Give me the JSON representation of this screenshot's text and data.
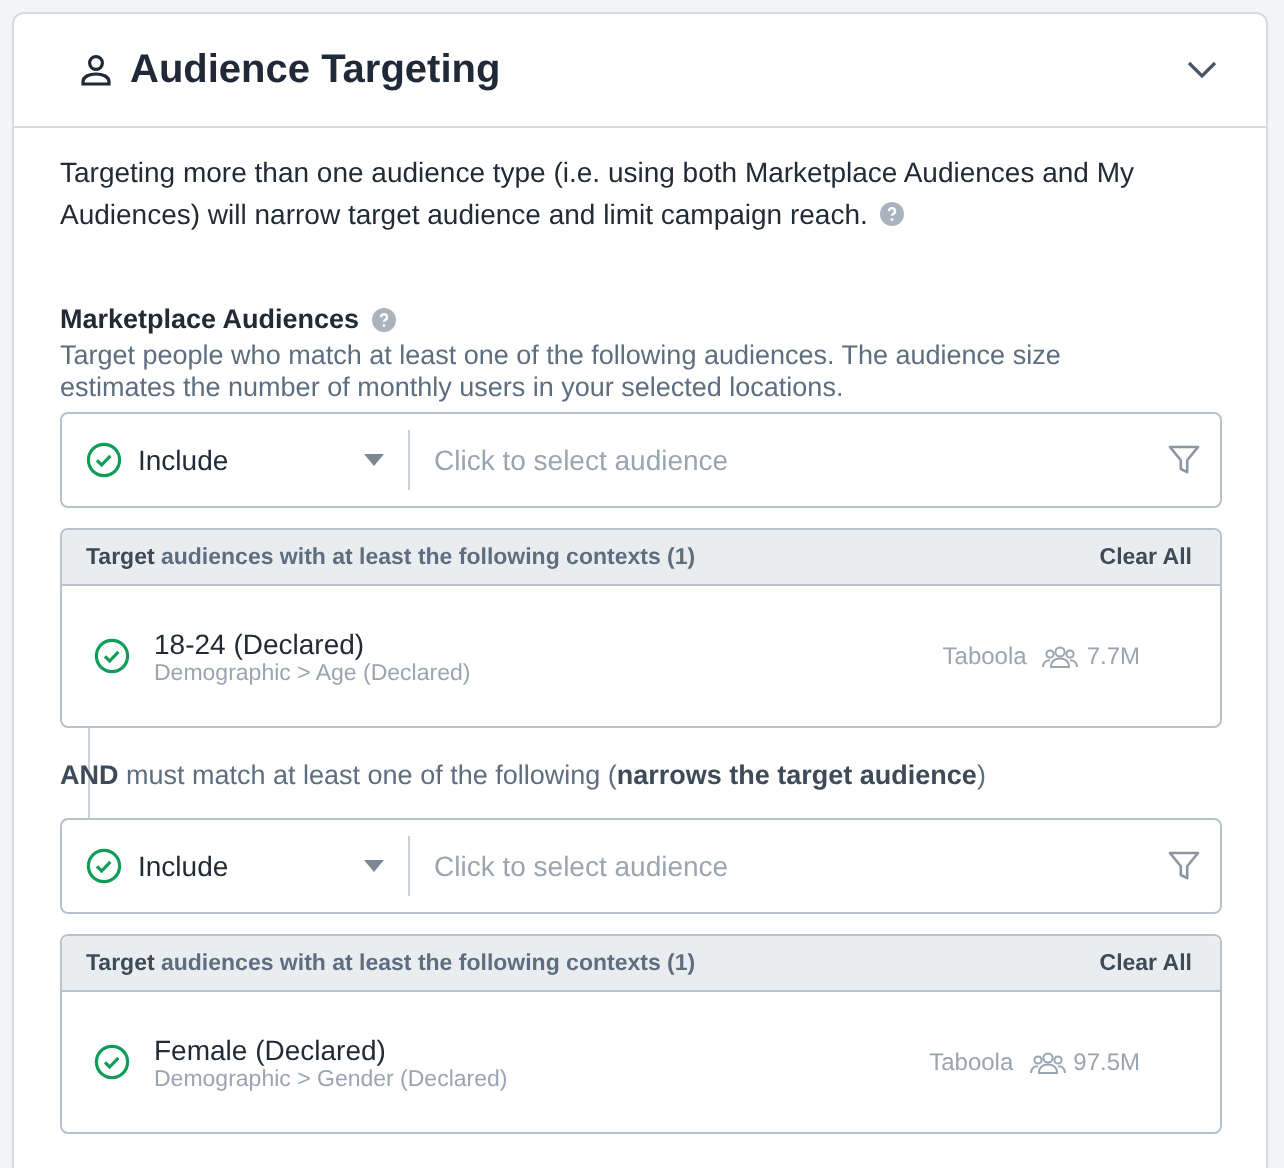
{
  "section": {
    "title": "Audience Targeting",
    "expanded": true
  },
  "notice": "Targeting more than one audience type (i.e. using both Marketplace Audiences and My Audiences) will narrow target audience and limit campaign reach.",
  "marketplace": {
    "title": "Marketplace Audiences",
    "description": "Target people who match at least one of the following audiences. The audience size estimates the number of monthly users in your selected locations.",
    "groups": [
      {
        "select": {
          "mode": "Include",
          "placeholder": "Click to select audience"
        },
        "contexts": {
          "header": "**Target** audiences with at least the following contexts (1)",
          "clear": "Clear All",
          "items": [
            {
              "name": "18-24 (Declared)",
              "path": "Demographic > Age (Declared)",
              "provider": "Taboola",
              "size": "7.7M"
            }
          ]
        }
      },
      {
        "connector": "**AND** must match at least one of the following (**narrows the target audience**)",
        "select": {
          "mode": "Include",
          "placeholder": "Click to select audience"
        },
        "contexts": {
          "header": "**Target** audiences with at least the following contexts (1)",
          "clear": "Clear All",
          "items": [
            {
              "name": "Female (Declared)",
              "path": "Demographic > Gender (Declared)",
              "provider": "Taboola",
              "size": "97.5M"
            }
          ]
        }
      }
    ]
  }
}
